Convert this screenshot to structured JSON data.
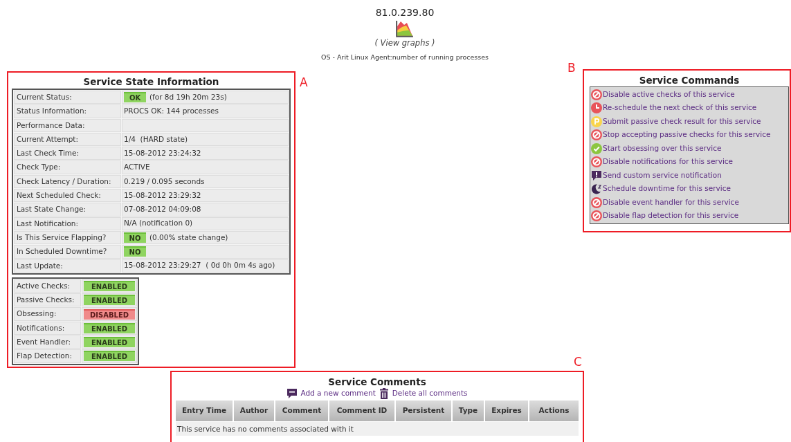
{
  "host": {
    "address": "81.0.239.80",
    "graphs_link": "( View graphs )",
    "service_name": "OS - Arit Linux Agent:number of running processes"
  },
  "state_panel": {
    "annotation": "A",
    "title": "Service State Information",
    "rows": [
      {
        "label": "Current Status:",
        "badge": {
          "text": "OK",
          "ok": true
        },
        "value": "(for 8d 19h 20m 23s)"
      },
      {
        "label": "Status Information:",
        "value": "PROCS OK: 144 processes"
      },
      {
        "label": "Performance Data:"
      },
      {
        "label": "Current Attempt:",
        "value": "1/4  (HARD state)"
      },
      {
        "label": "Last Check Time:",
        "value": "15-08-2012 23:24:32"
      },
      {
        "label": "Check Type:",
        "value": "ACTIVE"
      },
      {
        "label": "Check Latency / Duration:",
        "value": "0.219 / 0.095 seconds"
      },
      {
        "label": "Next Scheduled Check:",
        "value": "15-08-2012 23:29:32"
      },
      {
        "label": "Last State Change:",
        "value": "07-08-2012 04:09:08"
      },
      {
        "label": "Last Notification:",
        "value": "N/A (notification 0)"
      },
      {
        "label": "Is This Service Flapping?",
        "badge": {
          "text": "NO",
          "ok": true
        },
        "value": "(0.00% state change)"
      },
      {
        "label": "In Scheduled Downtime?",
        "badge": {
          "text": "NO",
          "ok": true
        }
      },
      {
        "label": "Last Update:",
        "value": "15-08-2012 23:29:27  ( 0d 0h 0m 4s ago)"
      }
    ],
    "toggles": [
      {
        "label": "Active Checks:",
        "value": "ENABLED",
        "enabled": true
      },
      {
        "label": "Passive Checks:",
        "value": "ENABLED",
        "enabled": true
      },
      {
        "label": "Obsessing:",
        "value": "DISABLED",
        "enabled": false
      },
      {
        "label": "Notifications:",
        "value": "ENABLED",
        "enabled": true
      },
      {
        "label": "Event Handler:",
        "value": "ENABLED",
        "enabled": true
      },
      {
        "label": "Flap Detection:",
        "value": "ENABLED",
        "enabled": true
      }
    ]
  },
  "commands_panel": {
    "annotation": "B",
    "title": "Service Commands",
    "commands": [
      {
        "kind": "disable",
        "label": "Disable active checks of this service"
      },
      {
        "kind": "reschedule",
        "label": "Re-schedule the next check of this service"
      },
      {
        "kind": "passive",
        "label": "Submit passive check result for this service"
      },
      {
        "kind": "disable",
        "label": "Stop accepting passive checks for this service"
      },
      {
        "kind": "enable",
        "label": "Start obsessing over this service"
      },
      {
        "kind": "disable",
        "label": "Disable notifications for this service"
      },
      {
        "kind": "notify",
        "label": "Send custom service notification"
      },
      {
        "kind": "downtime",
        "label": "Schedule downtime for this service"
      },
      {
        "kind": "disable",
        "label": "Disable event handler for this service"
      },
      {
        "kind": "disable",
        "label": "Disable flap detection for this service"
      }
    ]
  },
  "comments_panel": {
    "annotation": "C",
    "title": "Service Comments",
    "actions": [
      {
        "kind": "comment",
        "label": "Add a new comment"
      },
      {
        "kind": "trash",
        "label": "Delete all comments"
      }
    ],
    "columns": [
      "Entry Time",
      "Author",
      "Comment",
      "Comment ID",
      "Persistent",
      "Type",
      "Expires",
      "Actions"
    ],
    "empty_message": "This service has no comments associated with it"
  }
}
